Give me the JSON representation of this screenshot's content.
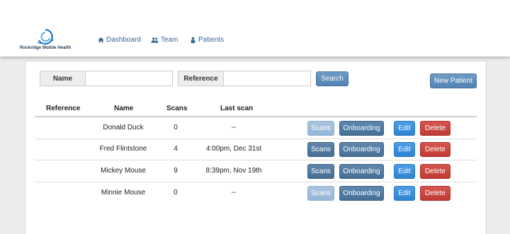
{
  "brand": {
    "name": "Rockridge Mobile Health"
  },
  "nav": [
    {
      "label": "Dashboard",
      "icon": "home-icon"
    },
    {
      "label": "Team",
      "icon": "team-icon"
    },
    {
      "label": "Patients",
      "icon": "user-icon"
    }
  ],
  "search": {
    "name_label": "Name",
    "name_value": "",
    "reference_label": "Reference",
    "reference_value": "",
    "search_button": "Search",
    "new_patient_button": "New Patient"
  },
  "table": {
    "headers": [
      "Reference",
      "Name",
      "Scans",
      "Last scan"
    ],
    "rows": [
      {
        "reference": "",
        "name": "Donald Duck",
        "scans": "0",
        "last_scan": "--",
        "scans_enabled": false
      },
      {
        "reference": "",
        "name": "Fred Flintstone",
        "scans": "4",
        "last_scan": "4:00pm, Dec 31st",
        "scans_enabled": true
      },
      {
        "reference": "",
        "name": "Mickey Mouse",
        "scans": "9",
        "last_scan": "8:39pm, Nov 19th",
        "scans_enabled": true
      },
      {
        "reference": "",
        "name": "Minnie Mouse",
        "scans": "0",
        "last_scan": "--",
        "scans_enabled": false
      }
    ],
    "actions": {
      "scans": "Scans",
      "onboarding": "Onboarding",
      "edit": "Edit",
      "delete": "Delete"
    }
  }
}
